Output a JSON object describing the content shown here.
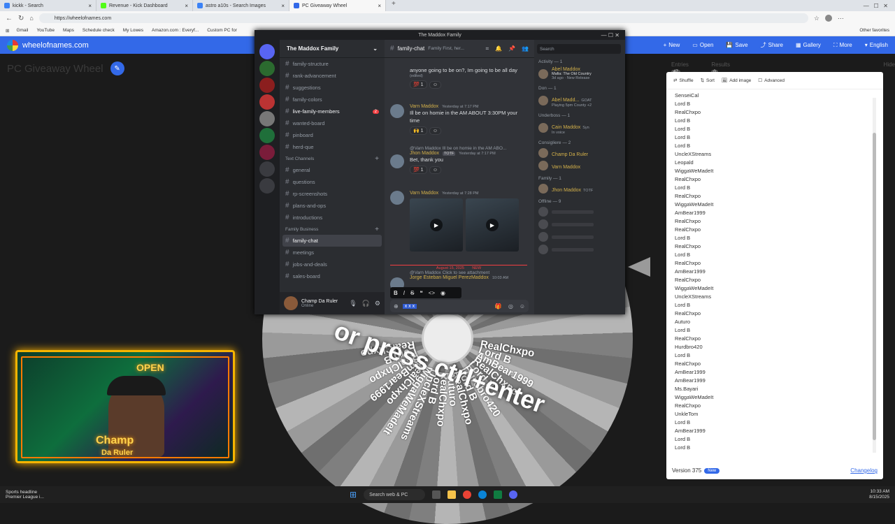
{
  "browser": {
    "tabs": [
      {
        "label": "kickk - Search",
        "color": "#3b82f6"
      },
      {
        "label": "Revenue - Kick Dashboard",
        "color": "#53fc18"
      },
      {
        "label": "astro a10s - Search Images",
        "color": "#3b82f6"
      },
      {
        "label": "PC Giveaway Wheel",
        "color": "#3369e8",
        "active": true
      }
    ],
    "url": "https://wheelofnames.com",
    "bookmarks": [
      "Gmail",
      "YouTube",
      "Maps",
      "Schedule check",
      "My Lowes",
      "Amazon.com : Everyf...",
      "Custom PC for"
    ],
    "other_favorites": "Other favorites"
  },
  "won": {
    "logo_text": "wheelofnames.com",
    "menu": [
      "New",
      "Open",
      "Save",
      "Share",
      "Gallery",
      "More",
      "English"
    ],
    "wheel_title": "PC Giveaway Wheel",
    "overlay_text": "or press ctrl+enter",
    "entries_tab": "Entries",
    "entries_count": "47",
    "results_tab": "Results",
    "results_count": "0",
    "hide_label": "Hide",
    "tools": [
      "Shuffle",
      "Sort",
      "Add image",
      "Advanced"
    ],
    "entries": [
      "SenseiCal",
      "Lord B",
      "RealChxpo",
      "Lord B",
      "Lord B",
      "Lord B",
      "Lord B",
      "UncleXStreams",
      "Leopald",
      "WiggaWeMadeIt",
      "RealChxpo",
      "Lord B",
      "RealChxpo",
      "WiggaWeMadeIt",
      "AmBear1999",
      "RealChxpo",
      "RealChxpo",
      "Lord B",
      "RealChxpo",
      "Lord B",
      "RealChxpo",
      "AmBear1999",
      "RealChxpo",
      "WiggaWeMadeIt",
      "UncleXStreams",
      "Lord B",
      "RealChxpo",
      "Auturo",
      "Lord B",
      "RealChxpo",
      "Hurdbro420",
      "Lord B",
      "RealChxpo",
      "AmBear1999",
      "AmBear1999",
      "Ms.Bayari",
      "WiggaWeMadeIt",
      "RealChxpo",
      "UnkleTom",
      "Lord B",
      "AmBear1999",
      "Lord B",
      "Lord B"
    ],
    "version": "Version 375",
    "version_badge": "New",
    "changelog": "Changelog",
    "wheel_labels": [
      "RealChxpo",
      "Lord B",
      "AmBear1999",
      "RealChxpo",
      "Lord B",
      "Hurdbro420",
      "Lord B",
      "RealChxpo",
      "Auturo",
      "RealChxpo",
      "Lord B",
      "UncleXStreams",
      "WiggaWeMadeIt",
      "RealChxpo",
      "AmBear1999",
      "RealChxpo",
      "Lord B",
      "RealChxpo"
    ]
  },
  "webcam": {
    "neon_sign": "OPEN",
    "overlay_name": "Champ",
    "overlay_sub": "Da Ruler"
  },
  "discord": {
    "window_title": "The Maddox Family",
    "server_name": "The Maddox Family",
    "channels_top": [
      {
        "name": "family-structure"
      },
      {
        "name": "rank-advancement"
      },
      {
        "name": "suggestions"
      },
      {
        "name": "family-colors"
      },
      {
        "name": "live-family-members",
        "bold": true,
        "badge": "2"
      },
      {
        "name": "wanted-board"
      },
      {
        "name": "pinboard"
      },
      {
        "name": "herd-que"
      }
    ],
    "category_text": "Text Channels",
    "channels_text": [
      "general",
      "questions",
      "rp-screenshots",
      "plans-and-ops",
      "introductions"
    ],
    "category_business": "Family Business",
    "channels_business": [
      "family-chat",
      "meetings",
      "jobs-and-deals",
      "sales-board"
    ],
    "user_name": "Champ Da Ruler",
    "user_status": "Online",
    "chat_channel": "family-chat",
    "chat_topic": "Family First, her...",
    "search_placeholder": "Search",
    "messages": [
      {
        "text": "anyone going to be on?, Im going to be all day",
        "edited": "(edited)",
        "react": "💯 1"
      },
      {
        "name": "Varn Maddox",
        "time": "Yesterday at 7:17 PM",
        "text": "Ill be on homie in the AM ABOUT 3:30PM your time",
        "react": "🙌 1"
      },
      {
        "reply": "@Varn Maddox Ill be on homie in the AM ABO...",
        "name": "Jhon Maddox",
        "tag": "TOTF",
        "time": "Yesterday at 7:17 PM",
        "text": "Bet, thank you",
        "react": "💯 1"
      },
      {
        "name": "Varn Maddox",
        "time": "Yesterday at 7:28 PM"
      }
    ],
    "date_sep": "August 15, 2025",
    "new_tag": "NEW",
    "last_reply": "@Varn Maddox Click to see attachment",
    "last_name": "Jorge Esteban Miguel PerezMaddox",
    "last_time": "10:03 AM",
    "composer_text": "x x x",
    "members": {
      "activity_title": "Activity — 1",
      "activity_name": "Abel Maddox",
      "activity_game": "Mafia: The Old Country",
      "activity_meta": "3d ago · New Release",
      "roles": [
        {
          "title": "Don — 1",
          "members": [
            {
              "name": "Abel Madd...",
              "tag": "GOAT",
              "status": "Playing 5pm County +2"
            }
          ]
        },
        {
          "title": "Underboss — 1",
          "members": [
            {
              "name": "Cain Maddox",
              "tag": "Syn",
              "status": "In voice"
            }
          ]
        },
        {
          "title": "Consigliere — 2",
          "members": [
            {
              "name": "Champ Da Ruler"
            },
            {
              "name": "Varn Maddox"
            }
          ]
        },
        {
          "title": "Family — 1",
          "members": [
            {
              "name": "Jhon Maddox",
              "tag": "TOTF"
            }
          ]
        }
      ],
      "offline_title": "Offline — 9"
    }
  },
  "taskbar": {
    "news_title": "Sports headline",
    "news_sub": "Premier League i...",
    "search": "Search web & PC",
    "time": "10:33 AM",
    "date": "8/15/2025"
  }
}
